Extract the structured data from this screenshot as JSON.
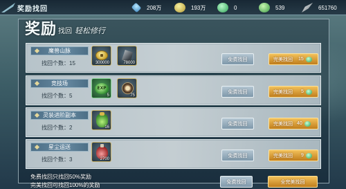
{
  "title": "奖励找回",
  "currencies": [
    {
      "icon": "diamond-icon",
      "value": "208万"
    },
    {
      "icon": "coin-icon",
      "value": "193万"
    },
    {
      "icon": "green-gem-icon",
      "value": "0"
    },
    {
      "icon": "green-coin-icon",
      "value": "539"
    },
    {
      "icon": "feather-icon",
      "value": "651760"
    }
  ],
  "header": {
    "big": "奖励",
    "small": "找回",
    "cursive": "轻松修行"
  },
  "count_label": "找回个数：",
  "rows": [
    {
      "name": "魔兽山脉",
      "count_text": "找回个数：15",
      "items": [
        {
          "icon": "gold-ingot-icon",
          "qty": "300000"
        },
        {
          "icon": "stone-icon",
          "qty": "78000"
        }
      ],
      "free_label": "免费找回",
      "perfect_label": "完美找回",
      "cost": "15"
    },
    {
      "name": "竞技场",
      "count_text": "找回个数：5",
      "items": [
        {
          "icon": "exp-orb-icon",
          "qty": "5"
        },
        {
          "icon": "bronze-orb-icon",
          "qty": "75"
        }
      ],
      "free_label": "免费找回",
      "perfect_label": "完美找回",
      "cost": "5"
    },
    {
      "name": "灵装进阶副本",
      "count_text": "找回个数：2",
      "items": [
        {
          "icon": "green-bag-icon",
          "qty": "16"
        }
      ],
      "free_label": "免费找回",
      "perfect_label": "完美找回",
      "cost": "40"
    },
    {
      "name": "星尘运送",
      "count_text": "找回个数：3",
      "items": [
        {
          "icon": "red-flask-icon",
          "qty": "2700"
        }
      ],
      "free_label": "免费找回",
      "perfect_label": "完美找回",
      "cost": "9"
    }
  ],
  "footer": {
    "note1": "免费找回只找回50%奖励",
    "note2": "完美找回可找回100%的奖励",
    "free_all": "免费找回",
    "perfect_all": "全完美找回"
  }
}
